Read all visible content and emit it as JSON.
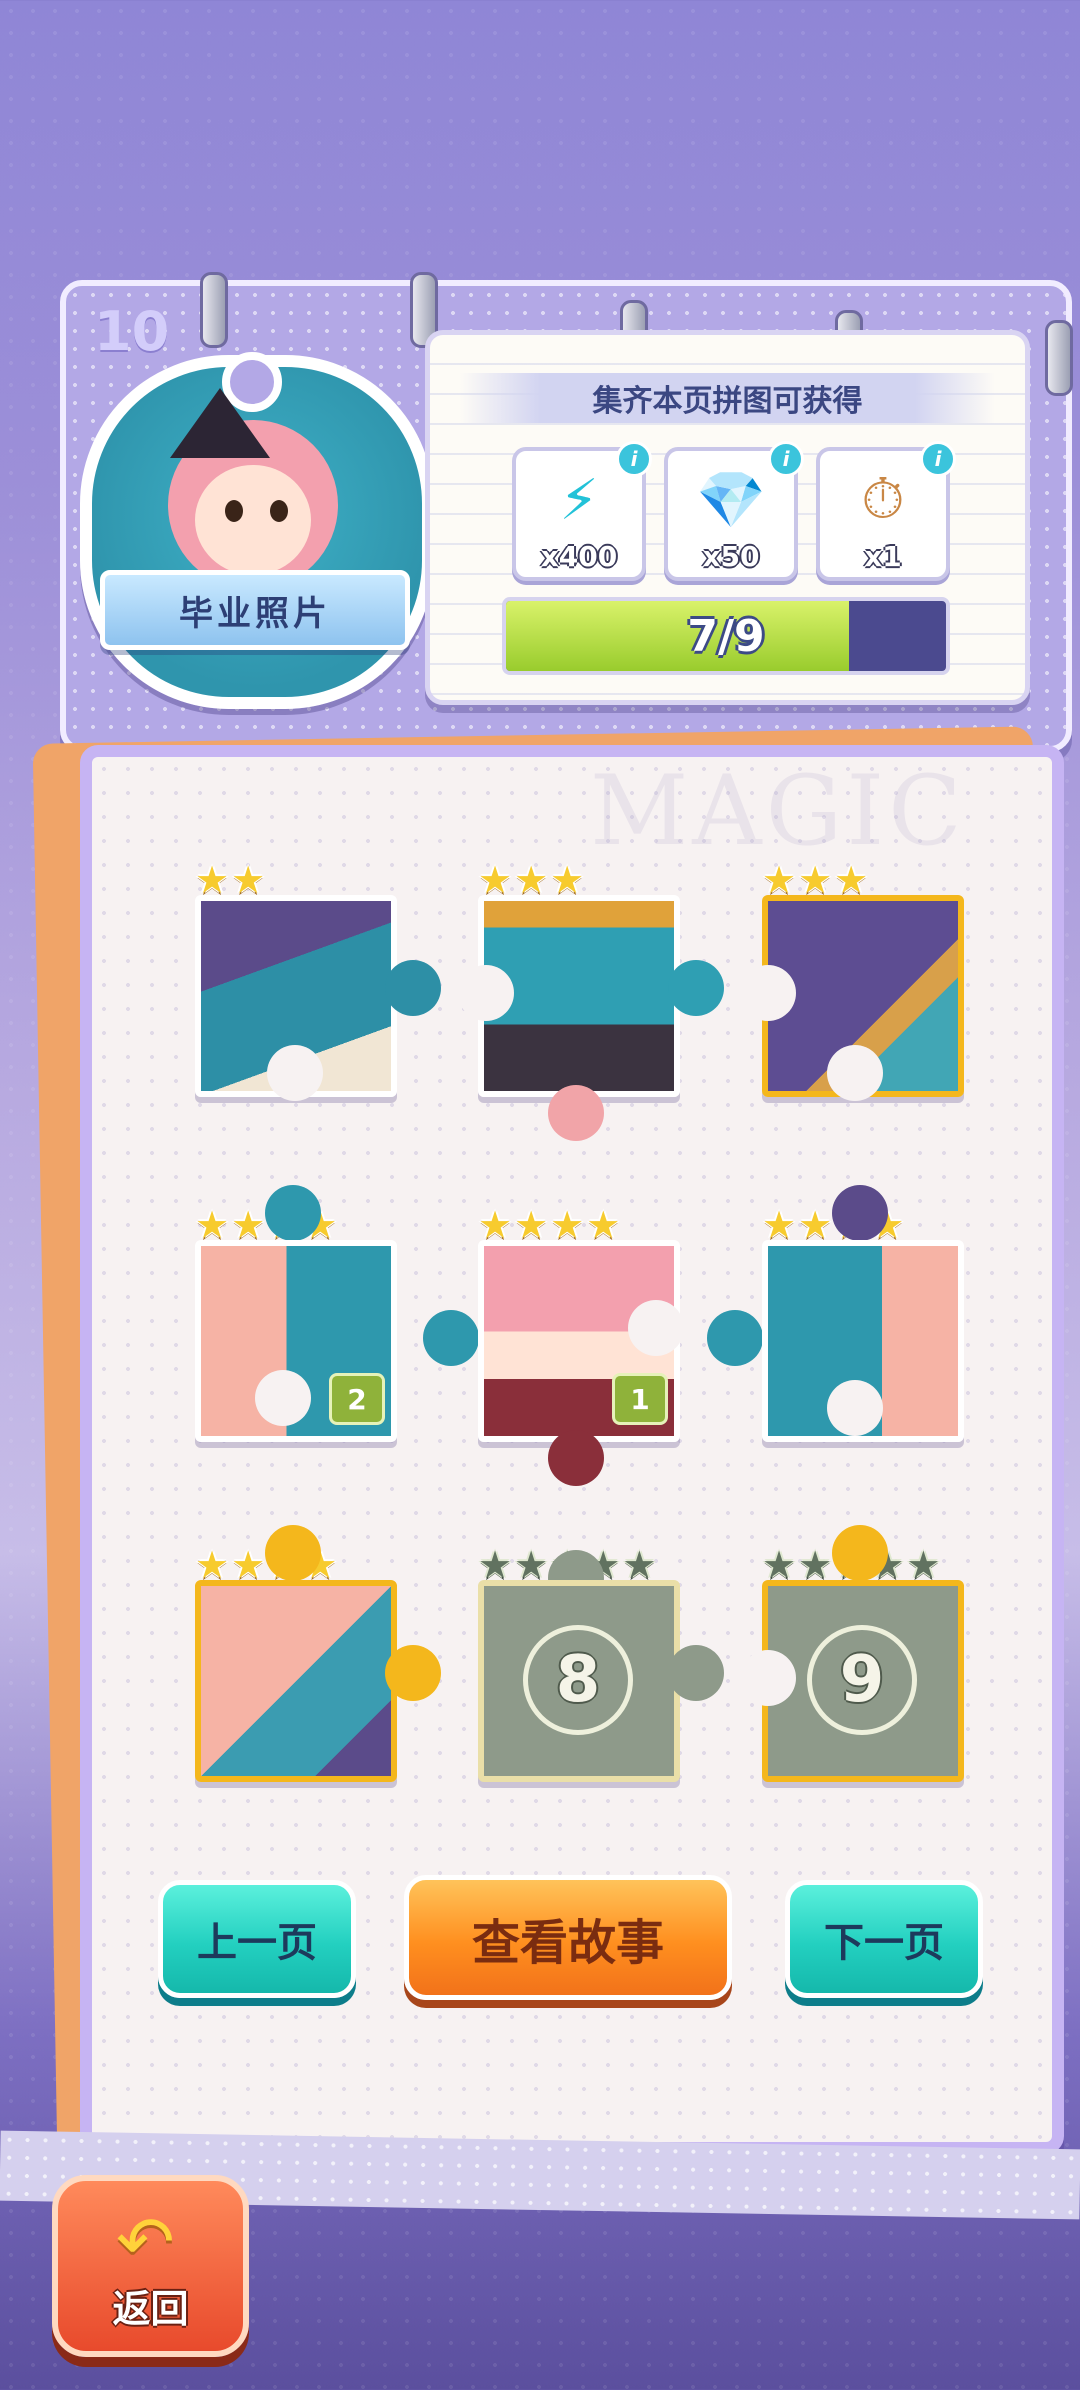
{
  "album": {
    "page_number": "10",
    "photo_title": "毕业照片"
  },
  "rewards": {
    "title": "集齐本页拼图可获得",
    "items": [
      {
        "icon": "energy-bolt-icon",
        "glyph": "⚡",
        "qty": "x400",
        "color": "#2fc4d6"
      },
      {
        "icon": "diamond-icon",
        "glyph": "💎",
        "qty": "x50",
        "color": "#4fc3f7"
      },
      {
        "icon": "stopwatch-icon",
        "glyph": "⏱",
        "qty": "x1",
        "color": "#c98745"
      }
    ],
    "progress_text": "7/9",
    "progress_fraction": 0.78
  },
  "watermark": "MAGIC",
  "pieces": [
    {
      "state": "done",
      "stars": 2,
      "max_stars": 2
    },
    {
      "state": "done",
      "stars": 3,
      "max_stars": 3
    },
    {
      "state": "done",
      "stars": 3,
      "max_stars": 3
    },
    {
      "state": "done",
      "stars": 4,
      "max_stars": 4,
      "count": "2"
    },
    {
      "state": "done",
      "stars": 4,
      "max_stars": 4,
      "count": "1"
    },
    {
      "state": "done",
      "stars": 4,
      "max_stars": 4
    },
    {
      "state": "done",
      "stars": 4,
      "max_stars": 4
    },
    {
      "state": "locked",
      "stars": 0,
      "max_stars": 5,
      "number": "8"
    },
    {
      "state": "locked",
      "stars": 0,
      "max_stars": 5,
      "number": "9"
    }
  ],
  "buttons": {
    "prev": "上一页",
    "story": "查看故事",
    "next": "下一页",
    "back": "返回"
  }
}
